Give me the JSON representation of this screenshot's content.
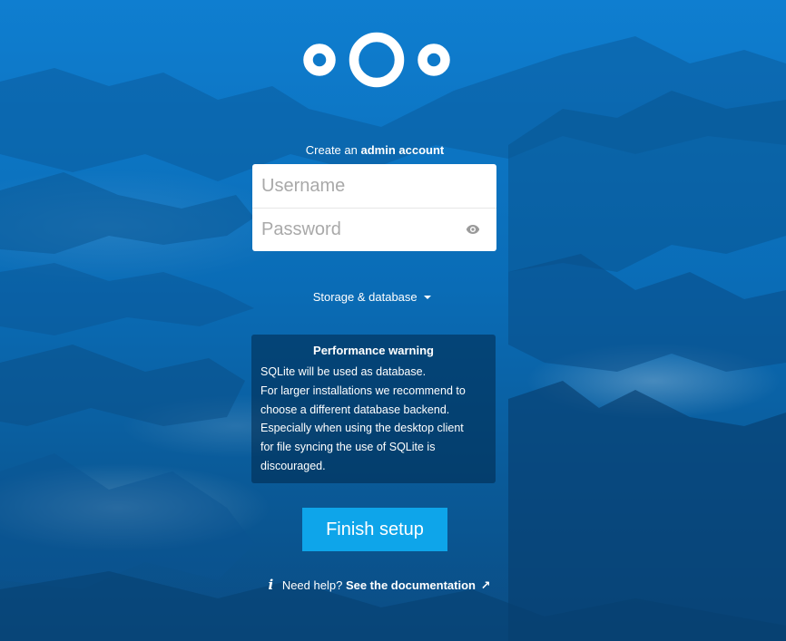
{
  "setup": {
    "subtitle_prefix": "Create an",
    "subtitle_bold": "admin account",
    "username_placeholder": "Username",
    "password_placeholder": "Password",
    "storage_label": "Storage & database",
    "warning": {
      "title": "Performance warning",
      "lines": [
        "SQLite will be used as database.",
        "For larger installations we recommend to",
        "choose a different database backend.",
        "Especially when using the desktop client",
        "for file syncing the use of SQLite is",
        "discouraged."
      ]
    },
    "finish_label": "Finish setup",
    "help_prefix": "Need help?",
    "help_link": "See the documentation",
    "help_arrow": "↗"
  },
  "icons": {
    "logo": "nextcloud-logo",
    "eye": "eye-icon",
    "info": "info-icon",
    "caret": "caret-down-icon",
    "external": "external-link-icon"
  },
  "colors": {
    "background": "#0a6cb6",
    "button": "#0ea5ea"
  }
}
